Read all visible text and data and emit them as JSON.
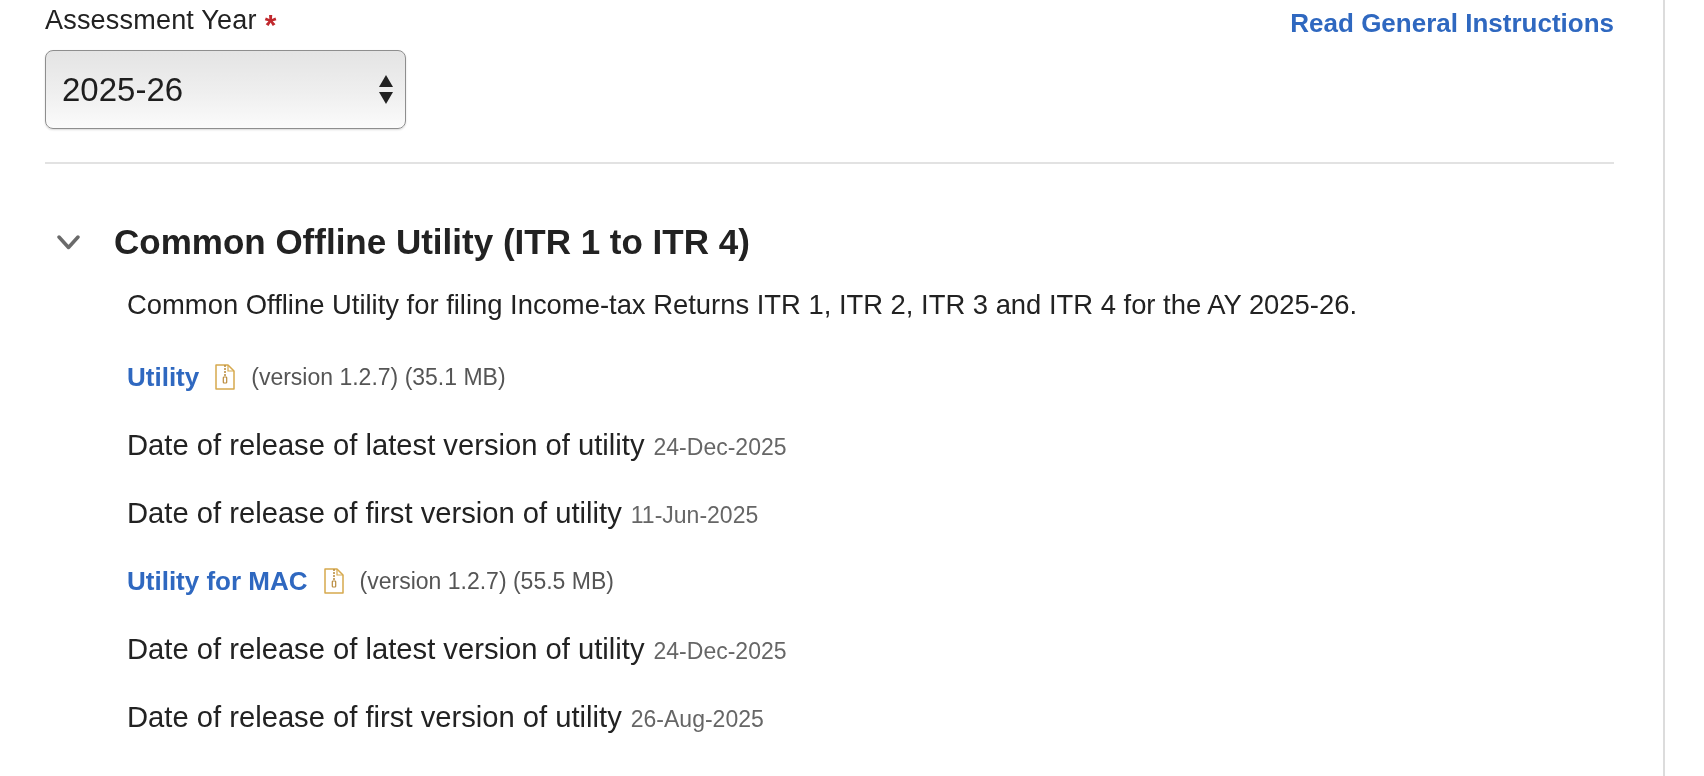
{
  "assessment_year": {
    "label": "Assessment Year",
    "required_mark": "*",
    "value": "2025-26"
  },
  "instructions_link": "Read General Instructions",
  "section": {
    "title": "Common Offline Utility (ITR 1 to ITR 4)",
    "expanded": true,
    "description": "Common Offline Utility for filing Income-tax Returns ITR 1, ITR 2, ITR 3 and ITR 4 for the AY 2025-26.",
    "downloads": [
      {
        "link": "Utility",
        "details": "(version 1.2.7) (35.1 MB)",
        "releases": [
          {
            "label": "Date of release of latest version of utility",
            "date": "24-Dec-2025"
          },
          {
            "label": "Date of release of first version of utility",
            "date": "11-Jun-2025"
          }
        ]
      },
      {
        "link": "Utility for MAC",
        "details": "(version 1.2.7) (55.5 MB)",
        "releases": [
          {
            "label": "Date of release of latest version of utility",
            "date": "24-Dec-2025"
          },
          {
            "label": "Date of release of first version of utility",
            "date": "26-Aug-2025"
          }
        ]
      }
    ]
  }
}
